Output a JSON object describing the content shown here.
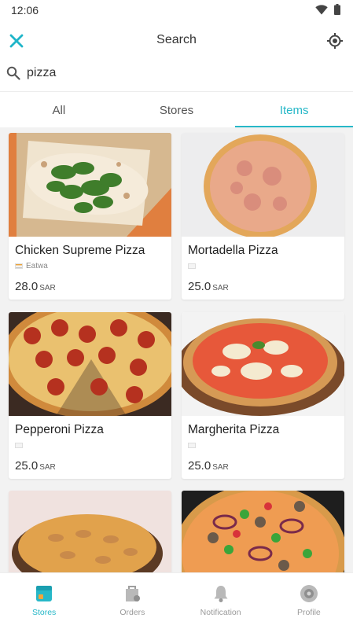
{
  "status_bar": {
    "time": "12:06"
  },
  "app_bar": {
    "title": "Search"
  },
  "search": {
    "query": "pizza"
  },
  "tabs": [
    {
      "label": "All",
      "active": false
    },
    {
      "label": "Stores",
      "active": false
    },
    {
      "label": "Items",
      "active": true
    }
  ],
  "items": [
    {
      "name": "Chicken Supreme Pizza",
      "store": "Eatwa",
      "price": "28.0",
      "currency": "SAR"
    },
    {
      "name": "Mortadella Pizza",
      "store": "",
      "price": "25.0",
      "currency": "SAR"
    },
    {
      "name": "Pepperoni Pizza",
      "store": "",
      "price": "25.0",
      "currency": "SAR"
    },
    {
      "name": "Margherita Pizza",
      "store": "",
      "price": "25.0",
      "currency": "SAR"
    }
  ],
  "bottom_nav": [
    {
      "label": "Stores",
      "icon": "store-icon",
      "active": true
    },
    {
      "label": "Orders",
      "icon": "orders-icon",
      "active": false
    },
    {
      "label": "Notification",
      "icon": "bell-icon",
      "active": false
    },
    {
      "label": "Profile",
      "icon": "profile-icon",
      "active": false
    }
  ],
  "colors": {
    "accent": "#27b8c8",
    "close_icon": "#1fb5c9",
    "inactive": "#9a9a9a"
  }
}
